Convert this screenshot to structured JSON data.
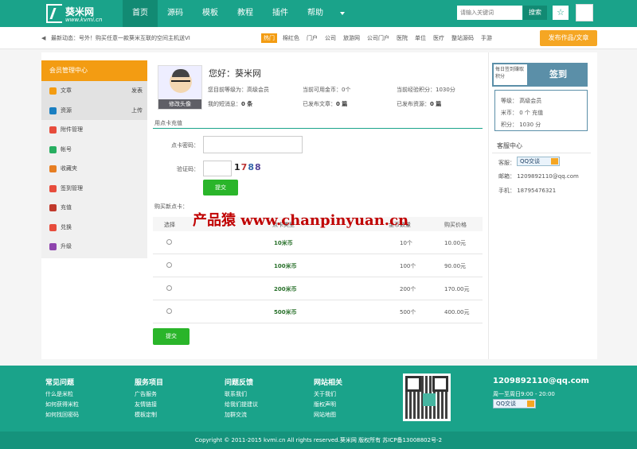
{
  "header": {
    "logo_name": "葵米网",
    "logo_domain": "www.kvmi.cn",
    "nav": [
      "首页",
      "源码",
      "模板",
      "教程",
      "插件",
      "帮助"
    ],
    "search_placeholder": "请输入关键词",
    "search_button": "搜索"
  },
  "news": {
    "text": "最新动态：号外！购买任意一款葵米互联的空间主机送VI",
    "hot": "热门",
    "tags": [
      "棉红色",
      "门户",
      "公司",
      "旅游网",
      "公司门户",
      "医院",
      "单位",
      "医疗",
      "整站源码",
      "手游"
    ],
    "publish": "发布作品/文章"
  },
  "sidebar": {
    "title": "会员管理中心",
    "items": [
      {
        "label": "文章",
        "right": "发表",
        "color": "#f39c12"
      },
      {
        "label": "资源",
        "right": "上传",
        "color": "#1a7fc1"
      },
      {
        "label": "附件管理",
        "right": "",
        "color": "#e74c3c"
      },
      {
        "label": "帐号",
        "right": "",
        "color": "#27ae60"
      },
      {
        "label": "收藏夹",
        "right": "",
        "color": "#e67e22"
      },
      {
        "label": "签到管理",
        "right": "",
        "color": "#e74c3c"
      },
      {
        "label": "充值",
        "right": "",
        "color": "#c0392b"
      },
      {
        "label": "兑换",
        "right": "",
        "color": "#e74c3c"
      },
      {
        "label": "升级",
        "right": "",
        "color": "#8e44ad"
      }
    ]
  },
  "profile": {
    "edit_avatar": "修改头像",
    "greeting": "您好：葵米网",
    "level": "您目前等级为：高级会员",
    "coins": "当前可用金币：0个",
    "points": "当前经验积分：1030分",
    "messages": "我的短消息：",
    "messages_val": "0 条",
    "articles": "已发布文章：",
    "articles_val": "0 篇",
    "resources": "已发布资源：",
    "resources_val": "0 篇"
  },
  "recharge": {
    "title": "用点卡充值",
    "card_label": "点卡密码：",
    "code_label": "验证码：",
    "captcha": [
      "1",
      "7",
      "8",
      "8"
    ],
    "submit": "提交"
  },
  "buy": {
    "title": "购买新点卡：",
    "headers": [
      "选择",
      "点卡类型",
      "金币数量",
      "购买价格"
    ],
    "rows": [
      {
        "name": "10米币",
        "count": "10个",
        "price": "10.00元"
      },
      {
        "name": "100米币",
        "count": "100个",
        "price": "90.00元"
      },
      {
        "name": "200米币",
        "count": "200个",
        "price": "170.00元"
      },
      {
        "name": "500米币",
        "count": "500个",
        "price": "400.00元"
      }
    ],
    "submit": "提交"
  },
  "watermark": "产品猿 www.chanpinyuan.cn",
  "sign": {
    "note": "每日签到赚取积分",
    "button": "签到",
    "level": "等级：  高级会员",
    "coins": "米币：  0 个 充值",
    "points": "积分：  1030 分"
  },
  "service": {
    "title": "客服中心",
    "qq_label": "客服：",
    "qq_btn": "QQ交谈",
    "email": "邮箱：  1209892110@qq.com",
    "phone": "手机：  18795476321"
  },
  "footer": {
    "cols": [
      {
        "title": "常见问题",
        "items": [
          "什么是米粒",
          "如何获得米粒",
          "如何找回密码"
        ]
      },
      {
        "title": "服务项目",
        "items": [
          "广告服务",
          "友情链接",
          "模板定制"
        ]
      },
      {
        "title": "问题反馈",
        "items": [
          "联系我们",
          "给我们提建议",
          "加群交流"
        ]
      },
      {
        "title": "网站相关",
        "items": [
          "关于我们",
          "版权声明",
          "网站地图"
        ]
      }
    ],
    "email": "1209892110@qq.com",
    "hours": "周一至周日9:00 - 20:00",
    "qq_btn": "QQ交谈",
    "copyright": "Copyright © 2011-2015 kvmi.cn All rights reserved.葵米网 版权所有  苏ICP备13008802号-2"
  }
}
